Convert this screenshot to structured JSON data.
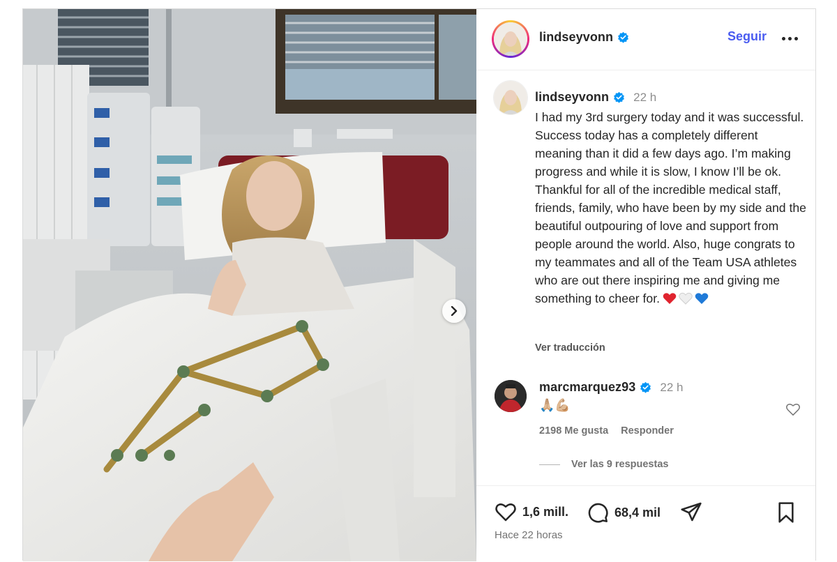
{
  "header": {
    "username": "lindseyvonn",
    "follow_label": "Seguir"
  },
  "caption": {
    "username": "lindseyvonn",
    "time": "22 h",
    "text": "I had my 3rd surgery today and it was successful. Success today has a completely different meaning than it did a few days ago. I’m making progress and while it is slow, I know I’ll be ok. Thankful for all of the incredible medical staff, friends, family, who have been by my side and the beautiful outpouring of love and support from people around the world. Also, huge congrats to my teammates and all of the Team USA athletes who are out there inspiring me and giving me something to cheer for.",
    "translate_label": "Ver traducción",
    "heart_colors": [
      "#e0242f",
      "#eeeeee",
      "#1f7ad8"
    ]
  },
  "comment": {
    "username": "marcmarquez93",
    "time": "22 h",
    "text": "🙏🏼💪🏼",
    "likes_label": "2198 Me gusta",
    "reply_label": "Responder",
    "view_replies_label": "Ver las 9 respuestas"
  },
  "actions": {
    "likes_count": "1,6 mill.",
    "comments_count": "68,4 mil",
    "posted": "Hace 22 horas"
  },
  "colors": {
    "accent": "#4a5cf0",
    "verified": "#0095f6"
  }
}
